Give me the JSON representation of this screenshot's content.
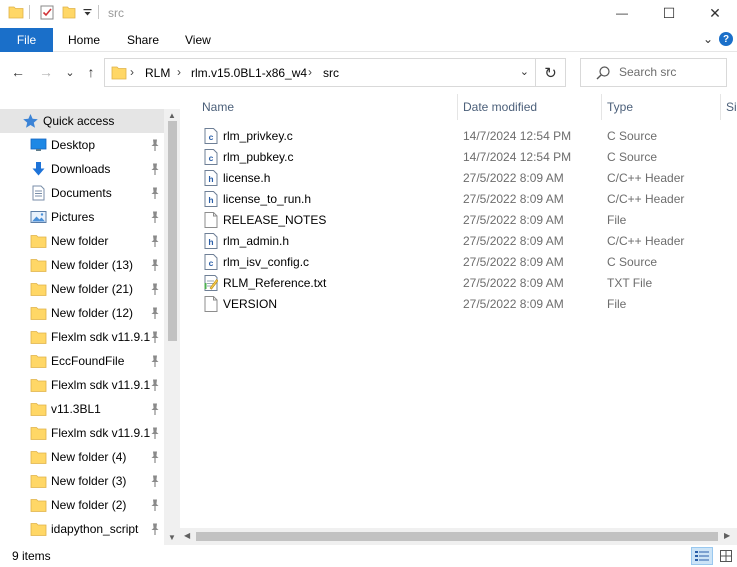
{
  "window": {
    "title": "src",
    "controls": {
      "minimize": "—",
      "maximize": "☐",
      "close": "✕"
    }
  },
  "ribbon": {
    "tabs": [
      "File",
      "Home",
      "Share",
      "View"
    ],
    "expand_glyph": "⌄",
    "help_glyph": "?"
  },
  "nav": {
    "back": "←",
    "forward": "→",
    "recent": "⌄",
    "up": "↑"
  },
  "address": {
    "root_sep": "›",
    "crumbs": [
      "RLM",
      "rlm.v15.0BL1-x86_w4",
      "src"
    ],
    "sep": "›",
    "dropdown": "⌄",
    "refresh": "↻"
  },
  "search": {
    "placeholder": "Search src"
  },
  "sidebar": {
    "items": [
      {
        "label": "Quick access",
        "icon": "star-icon",
        "pinned": false,
        "selected": true
      },
      {
        "label": "Desktop",
        "icon": "desktop-icon",
        "pinned": true
      },
      {
        "label": "Downloads",
        "icon": "download-icon",
        "pinned": true
      },
      {
        "label": "Documents",
        "icon": "documents-icon",
        "pinned": true
      },
      {
        "label": "Pictures",
        "icon": "pictures-icon",
        "pinned": true
      },
      {
        "label": "New folder",
        "icon": "folder-icon",
        "pinned": true
      },
      {
        "label": "New folder (13)",
        "icon": "folder-icon",
        "pinned": true
      },
      {
        "label": "New folder (21)",
        "icon": "folder-icon",
        "pinned": true
      },
      {
        "label": "New folder (12)",
        "icon": "folder-icon",
        "pinned": true
      },
      {
        "label": "Flexlm sdk v11.9.1",
        "icon": "folder-icon",
        "pinned": true
      },
      {
        "label": "EccFoundFile",
        "icon": "folder-icon",
        "pinned": true
      },
      {
        "label": "Flexlm sdk v11.9.1",
        "icon": "folder-icon",
        "pinned": true
      },
      {
        "label": "v11.3BL1",
        "icon": "folder-icon",
        "pinned": true
      },
      {
        "label": "Flexlm sdk v11.9.1",
        "icon": "folder-icon",
        "pinned": true
      },
      {
        "label": "New folder (4)",
        "icon": "folder-icon",
        "pinned": true
      },
      {
        "label": "New folder (3)",
        "icon": "folder-icon",
        "pinned": true
      },
      {
        "label": "New folder (2)",
        "icon": "folder-icon",
        "pinned": true
      },
      {
        "label": "idapython_script",
        "icon": "folder-icon",
        "pinned": true
      }
    ]
  },
  "columns": {
    "name": "Name",
    "date": "Date modified",
    "type": "Type",
    "size": "Si"
  },
  "files": [
    {
      "name": "rlm_privkey.c",
      "date": "14/7/2024 12:54 PM",
      "type": "C Source",
      "icon": "c-source-icon"
    },
    {
      "name": "rlm_pubkey.c",
      "date": "14/7/2024 12:54 PM",
      "type": "C Source",
      "icon": "c-source-icon"
    },
    {
      "name": "license.h",
      "date": "27/5/2022 8:09 AM",
      "type": "C/C++ Header",
      "icon": "header-file-icon"
    },
    {
      "name": "license_to_run.h",
      "date": "27/5/2022 8:09 AM",
      "type": "C/C++ Header",
      "icon": "header-file-icon"
    },
    {
      "name": "RELEASE_NOTES",
      "date": "27/5/2022 8:09 AM",
      "type": "File",
      "icon": "blank-file-icon"
    },
    {
      "name": "rlm_admin.h",
      "date": "27/5/2022 8:09 AM",
      "type": "C/C++ Header",
      "icon": "header-file-icon"
    },
    {
      "name": "rlm_isv_config.c",
      "date": "27/5/2022 8:09 AM",
      "type": "C Source",
      "icon": "c-source-icon"
    },
    {
      "name": "RLM_Reference.txt",
      "date": "27/5/2022 8:09 AM",
      "type": "TXT File",
      "icon": "text-file-icon"
    },
    {
      "name": "VERSION",
      "date": "27/5/2022 8:09 AM",
      "type": "File",
      "icon": "blank-file-icon"
    }
  ],
  "status": {
    "item_count": "9 items"
  },
  "colors": {
    "accent": "#1a6fc9",
    "folder": "#ffd766",
    "selected": "#e5e5e5",
    "header_text": "#4c607a"
  }
}
